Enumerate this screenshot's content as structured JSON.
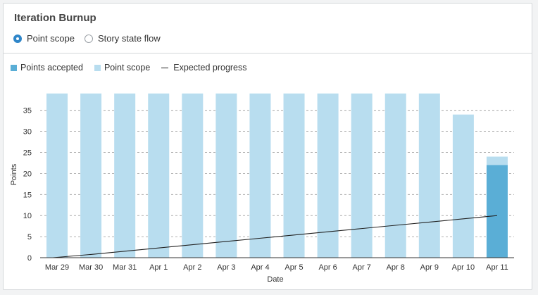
{
  "header": {
    "title": "Iteration Burnup",
    "options": [
      {
        "label": "Point scope",
        "selected": true
      },
      {
        "label": "Story state flow",
        "selected": false
      }
    ]
  },
  "legend": [
    {
      "label": "Points accepted",
      "color": "#5aaed6",
      "kind": "box"
    },
    {
      "label": "Point scope",
      "color": "#b8ddef",
      "kind": "box"
    },
    {
      "label": "Expected progress",
      "color": "#222222",
      "kind": "line"
    }
  ],
  "chart_data": {
    "type": "bar",
    "categories": [
      "Mar 29",
      "Mar 30",
      "Mar 31",
      "Apr 1",
      "Apr 2",
      "Apr 3",
      "Apr 4",
      "Apr 5",
      "Apr 6",
      "Apr 7",
      "Apr 8",
      "Apr 9",
      "Apr 10",
      "Apr 11"
    ],
    "series": [
      {
        "name": "Point scope",
        "values": [
          39,
          39,
          39,
          39,
          39,
          39,
          39,
          39,
          39,
          39,
          39,
          39,
          34,
          24
        ],
        "color": "#b8ddef"
      },
      {
        "name": "Points accepted",
        "values": [
          0,
          0,
          0,
          0,
          0,
          0,
          0,
          0,
          0,
          0,
          0,
          0,
          0,
          22
        ],
        "color": "#5aaed6"
      },
      {
        "name": "Expected progress",
        "type": "line",
        "values": [
          0,
          0.77,
          1.54,
          2.31,
          3.08,
          3.85,
          4.62,
          5.38,
          6.15,
          6.92,
          7.69,
          8.46,
          9.23,
          10
        ],
        "color": "#222222"
      }
    ],
    "xlabel": "Date",
    "ylabel": "Points",
    "ylim": [
      0,
      39
    ],
    "yticks": [
      0,
      5,
      10,
      15,
      20,
      25,
      30,
      35
    ],
    "grid": true,
    "legend_position": "top-left"
  }
}
